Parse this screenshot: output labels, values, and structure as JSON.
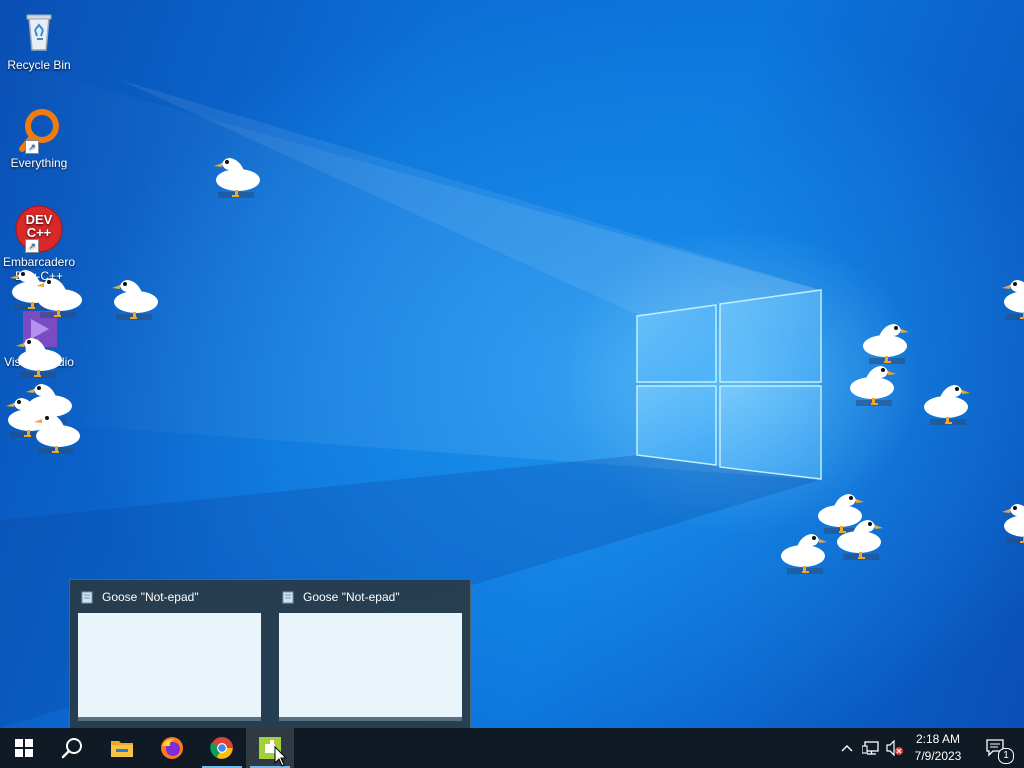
{
  "desktop": {
    "icons": [
      {
        "label": "Recycle Bin",
        "icon": "recycle-bin-icon"
      },
      {
        "label": "Everything",
        "icon": "everything-search-icon"
      },
      {
        "label": "Embarcadero Dev-C++",
        "icon": "devcpp-icon",
        "badge_text": "DEV C++"
      },
      {
        "label": "Visual Studio",
        "icon": "visual-studio-icon"
      }
    ]
  },
  "thumbnail_popup": {
    "items": [
      {
        "title": "Goose \"Not-epad\""
      },
      {
        "title": "Goose \"Not-epad\""
      }
    ]
  },
  "taskbar": {
    "buttons": [
      {
        "name": "start",
        "icon": "windows-logo-icon"
      },
      {
        "name": "search",
        "icon": "search-icon"
      },
      {
        "name": "file-explorer",
        "icon": "folder-icon"
      },
      {
        "name": "firefox",
        "icon": "firefox-icon"
      },
      {
        "name": "chrome",
        "icon": "chrome-icon"
      },
      {
        "name": "desktop-goose",
        "icon": "goose-app-icon"
      }
    ],
    "tray": {
      "time": "2:18 AM",
      "date": "7/9/2023",
      "notification_count": "1"
    }
  },
  "colors": {
    "taskbar_bg": "#0f1a24",
    "active_indicator": "#76b9ed",
    "popup_bg": "#283c4b"
  }
}
